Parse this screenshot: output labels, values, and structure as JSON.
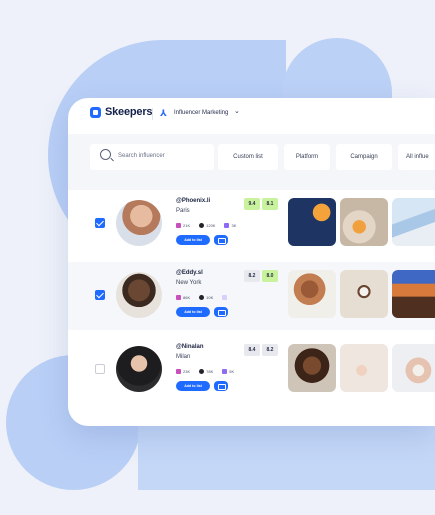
{
  "app": {
    "brand": "Skeepers",
    "product": "Influencer Marketing"
  },
  "filters": {
    "search_placeholder": "Search influencer",
    "chips": [
      "Custom list",
      "Platform",
      "Campaign",
      "All influe"
    ]
  },
  "influencers": [
    {
      "checked": true,
      "handle": "@Phoenix.li",
      "city": "Paris",
      "scores": [
        {
          "value": "9.4",
          "tone": "green"
        },
        {
          "value": "8.1",
          "tone": "green"
        }
      ],
      "socials": [
        {
          "platform": "instagram",
          "count": "21K"
        },
        {
          "platform": "tiktok",
          "count": "120K"
        },
        {
          "platform": "youtube",
          "count": "3K"
        }
      ],
      "add_label": "Add to list"
    },
    {
      "checked": true,
      "handle": "@Eddy.sl",
      "city": "New York",
      "scores": [
        {
          "value": "8.2",
          "tone": "gray"
        },
        {
          "value": "8.0",
          "tone": "green"
        }
      ],
      "socials": [
        {
          "platform": "instagram",
          "count": "86K"
        },
        {
          "platform": "tiktok",
          "count": "10K"
        },
        {
          "platform": "youtube",
          "count": ""
        }
      ],
      "add_label": "Add to list"
    },
    {
      "checked": false,
      "handle": "@Ninalan",
      "city": "Milan",
      "scores": [
        {
          "value": "8.4",
          "tone": "gray"
        },
        {
          "value": "8.2",
          "tone": "gray"
        }
      ],
      "socials": [
        {
          "platform": "instagram",
          "count": "23K"
        },
        {
          "platform": "tiktok",
          "count": "78K"
        },
        {
          "platform": "youtube",
          "count": "5K"
        }
      ],
      "add_label": "Add to list"
    }
  ],
  "colors": {
    "accent": "#1f6bff",
    "score_green": "#c9f29d",
    "score_gray": "#e7e9ee",
    "background_shape": "#b9cff6"
  }
}
